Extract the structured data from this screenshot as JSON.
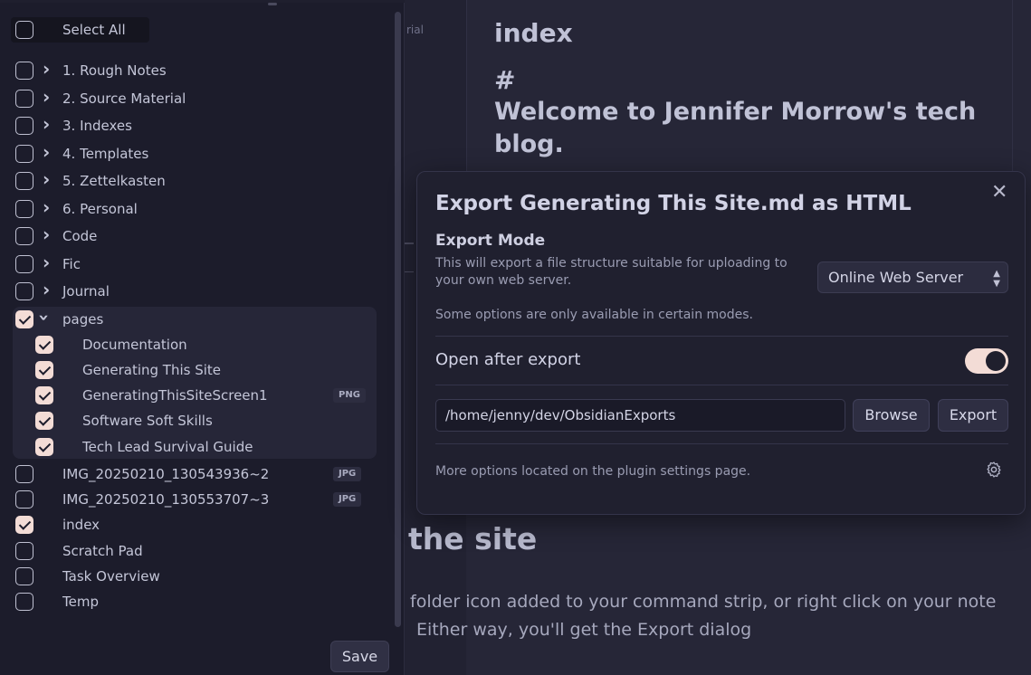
{
  "background": {
    "sidebar_fragment": "rial",
    "note_title": "index",
    "note_hash": "#",
    "note_heading": "Welcome to Jennifer Morrow's tech blog.",
    "section_heading_fragment": "the site",
    "paragraph_line1": "folder icon added to your command strip, or right click on your note",
    "paragraph_line2": "Either way, you'll get the Export dialog"
  },
  "file_list": {
    "select_all_label": "Select All",
    "items": [
      {
        "label": "1. Rough Notes",
        "checked": false,
        "folder": true
      },
      {
        "label": "2. Source Material",
        "checked": false,
        "folder": true
      },
      {
        "label": "3. Indexes",
        "checked": false,
        "folder": true
      },
      {
        "label": "4. Templates",
        "checked": false,
        "folder": true
      },
      {
        "label": "5. Zettelkasten",
        "checked": false,
        "folder": true
      },
      {
        "label": "6. Personal",
        "checked": false,
        "folder": true
      },
      {
        "label": "Code",
        "checked": false,
        "folder": true
      },
      {
        "label": "Fic",
        "checked": false,
        "folder": true
      },
      {
        "label": "Journal",
        "checked": false,
        "folder": true
      },
      {
        "label": "pages",
        "checked": true,
        "folder": true,
        "expanded": true
      },
      {
        "label": "Documentation",
        "checked": true,
        "child": true
      },
      {
        "label": "Generating This Site",
        "checked": true,
        "child": true
      },
      {
        "label": "GeneratingThisSiteScreen1",
        "checked": true,
        "child": true,
        "badge": "PNG"
      },
      {
        "label": "Software Soft Skills",
        "checked": true,
        "child": true
      },
      {
        "label": "Tech Lead Survival Guide",
        "checked": true,
        "child": true
      },
      {
        "label": "IMG_20250210_130543936~2",
        "checked": false,
        "badge": "JPG"
      },
      {
        "label": "IMG_20250210_130553707~3",
        "checked": false,
        "badge": "JPG"
      },
      {
        "label": "index",
        "checked": true
      },
      {
        "label": "Scratch Pad",
        "checked": false
      },
      {
        "label": "Task Overview",
        "checked": false
      },
      {
        "label": "Temp",
        "checked": false
      }
    ],
    "save_label": "Save"
  },
  "modal": {
    "title": "Export Generating This Site.md as HTML",
    "close_glyph": "✕",
    "mode_label": "Export Mode",
    "mode_desc": "This will export a file structure suitable for uploading to your own web server.",
    "mode_value": "Online Web Server",
    "mode_note": "Some options are only available in certain modes.",
    "open_after_label": "Open after export",
    "open_after_on": true,
    "path_value": "/home/jenny/dev/ObsidianExports",
    "browse_label": "Browse",
    "export_label": "Export",
    "more_note": "More options located on the plugin settings page.",
    "accent_color": "#f3dcd6"
  }
}
